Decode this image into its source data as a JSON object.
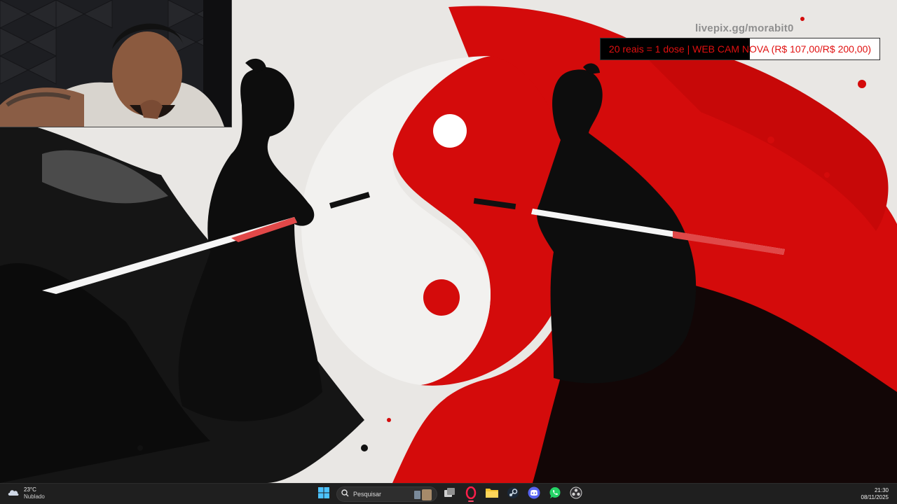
{
  "overlay": {
    "livepix_link": "livepix.gg/morabit0",
    "goal_text": "20 reais = 1 dose | WEB CAM NOVA (R$ 107,00/R$ 200,00)",
    "goal_progress": 0.535,
    "goal_text_color": "#e01010"
  },
  "taskbar": {
    "weather_temp": "23°C",
    "weather_condition": "Nublado",
    "search_placeholder": "Pesquisar",
    "time": "21:30",
    "date": "08/11/2025",
    "pinned_apps": [
      "start-icon",
      "task-view-icon",
      "opera-gx-icon",
      "file-explorer-icon",
      "steam-icon",
      "discord-icon",
      "whatsapp-icon",
      "obs-icon"
    ]
  },
  "colors": {
    "accent_red": "#d40b0b",
    "taskbar_bg": "#1f1f1f"
  }
}
